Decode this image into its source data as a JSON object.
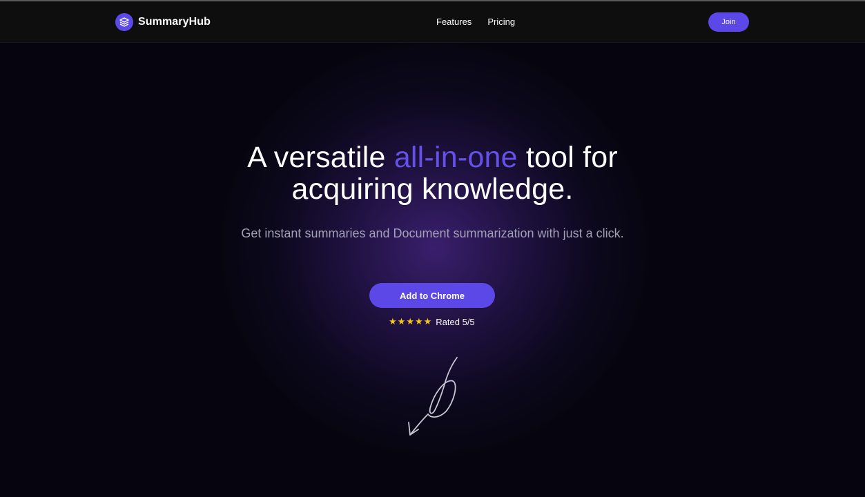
{
  "brand": {
    "name": "SummaryHub",
    "logo_icon": "layers-icon",
    "logo_color": "#5b4ae8"
  },
  "nav": {
    "links": [
      "Features",
      "Pricing"
    ],
    "join_label": "Join"
  },
  "hero": {
    "title_before": "A versatile ",
    "title_accent": "all-in-one",
    "title_after_line1": " tool for",
    "title_line2": "acquiring knowledge.",
    "subtitle": "Get instant summaries and Document summarization with just a click.",
    "cta_label": "Add to Chrome",
    "rating_stars": 5,
    "rating_text": "Rated 5/5",
    "decoration_icon": "hand-drawn-arrow-icon"
  },
  "colors": {
    "accent": "#5b48e6",
    "accent_text": "#6451e8",
    "background": "#06050f",
    "navbar": "#0e0e0e",
    "star": "#f5c518"
  }
}
